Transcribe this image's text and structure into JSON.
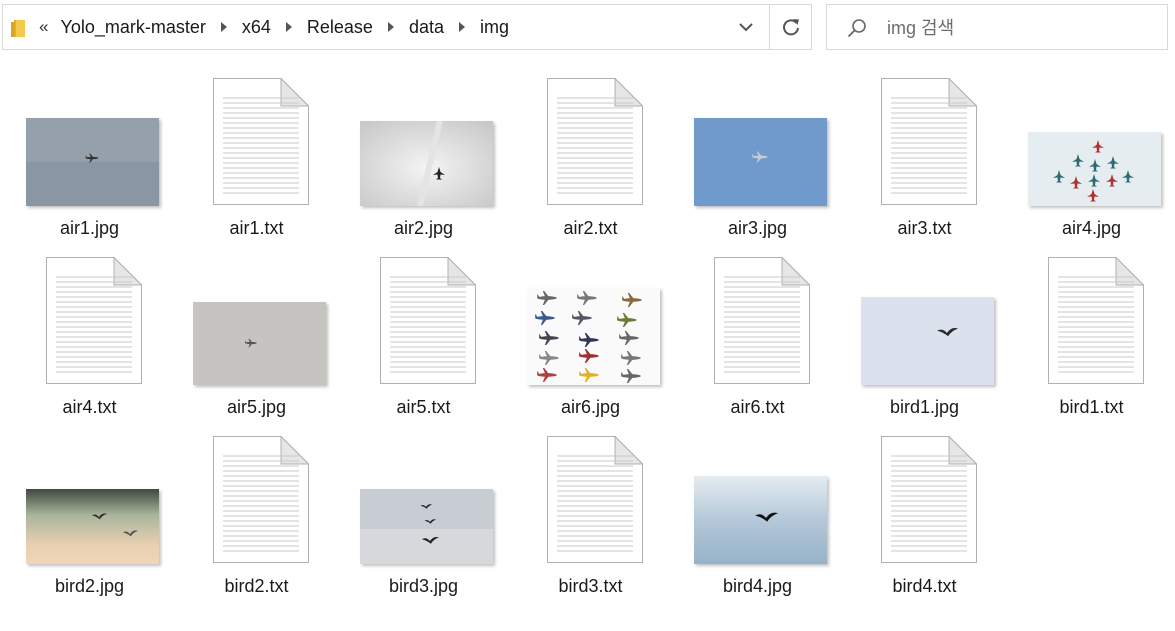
{
  "address_bar": {
    "overflow": "«",
    "breadcrumbs": [
      "Yolo_mark-master",
      "x64",
      "Release",
      "data",
      "img"
    ]
  },
  "search": {
    "placeholder": "img 검색"
  },
  "colors": {
    "border": "#d9d9d9",
    "folder": "#e8b94a",
    "doc_line": "#c9c9c9",
    "sky_blue": "#6f9acb"
  },
  "files": [
    {
      "name": "air1.jpg",
      "kind": "image",
      "scene": "gray-plane"
    },
    {
      "name": "air1.txt",
      "kind": "text"
    },
    {
      "name": "air2.jpg",
      "kind": "image",
      "scene": "white-jet-contrail"
    },
    {
      "name": "air2.txt",
      "kind": "text"
    },
    {
      "name": "air3.jpg",
      "kind": "image",
      "scene": "blue-sky-plane"
    },
    {
      "name": "air3.txt",
      "kind": "text"
    },
    {
      "name": "air4.jpg",
      "kind": "image",
      "scene": "jet-formation"
    },
    {
      "name": "air4.txt",
      "kind": "text"
    },
    {
      "name": "air5.jpg",
      "kind": "image",
      "scene": "gray-plane-light"
    },
    {
      "name": "air5.txt",
      "kind": "text"
    },
    {
      "name": "air6.jpg",
      "kind": "image",
      "scene": "aircraft-collage"
    },
    {
      "name": "air6.txt",
      "kind": "text"
    },
    {
      "name": "bird1.jpg",
      "kind": "image",
      "scene": "bird-pale-sky"
    },
    {
      "name": "bird1.txt",
      "kind": "text"
    },
    {
      "name": "bird2.jpg",
      "kind": "image",
      "scene": "birds-sunset"
    },
    {
      "name": "bird2.txt",
      "kind": "text"
    },
    {
      "name": "bird3.jpg",
      "kind": "image",
      "scene": "birds-cloudy"
    },
    {
      "name": "bird3.txt",
      "kind": "text"
    },
    {
      "name": "bird4.jpg",
      "kind": "image",
      "scene": "bird-cloud-sky"
    },
    {
      "name": "bird4.txt",
      "kind": "text"
    }
  ]
}
